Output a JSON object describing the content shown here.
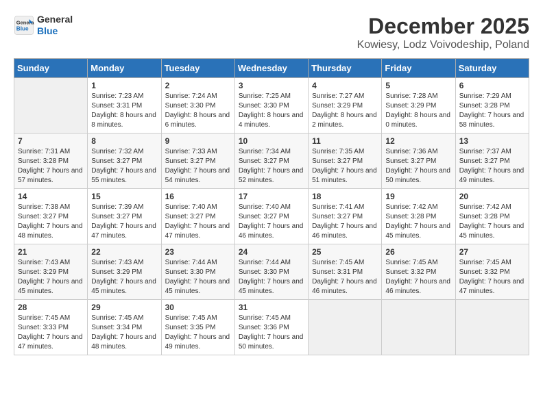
{
  "logo": {
    "line1": "General",
    "line2": "Blue"
  },
  "title": "December 2025",
  "subtitle": "Kowiesy, Lodz Voivodeship, Poland",
  "days_of_week": [
    "Sunday",
    "Monday",
    "Tuesday",
    "Wednesday",
    "Thursday",
    "Friday",
    "Saturday"
  ],
  "weeks": [
    [
      {
        "day": "",
        "sunrise": "",
        "sunset": "",
        "daylight": ""
      },
      {
        "day": "1",
        "sunrise": "Sunrise: 7:23 AM",
        "sunset": "Sunset: 3:31 PM",
        "daylight": "Daylight: 8 hours and 8 minutes."
      },
      {
        "day": "2",
        "sunrise": "Sunrise: 7:24 AM",
        "sunset": "Sunset: 3:30 PM",
        "daylight": "Daylight: 8 hours and 6 minutes."
      },
      {
        "day": "3",
        "sunrise": "Sunrise: 7:25 AM",
        "sunset": "Sunset: 3:30 PM",
        "daylight": "Daylight: 8 hours and 4 minutes."
      },
      {
        "day": "4",
        "sunrise": "Sunrise: 7:27 AM",
        "sunset": "Sunset: 3:29 PM",
        "daylight": "Daylight: 8 hours and 2 minutes."
      },
      {
        "day": "5",
        "sunrise": "Sunrise: 7:28 AM",
        "sunset": "Sunset: 3:29 PM",
        "daylight": "Daylight: 8 hours and 0 minutes."
      },
      {
        "day": "6",
        "sunrise": "Sunrise: 7:29 AM",
        "sunset": "Sunset: 3:28 PM",
        "daylight": "Daylight: 7 hours and 58 minutes."
      }
    ],
    [
      {
        "day": "7",
        "sunrise": "Sunrise: 7:31 AM",
        "sunset": "Sunset: 3:28 PM",
        "daylight": "Daylight: 7 hours and 57 minutes."
      },
      {
        "day": "8",
        "sunrise": "Sunrise: 7:32 AM",
        "sunset": "Sunset: 3:27 PM",
        "daylight": "Daylight: 7 hours and 55 minutes."
      },
      {
        "day": "9",
        "sunrise": "Sunrise: 7:33 AM",
        "sunset": "Sunset: 3:27 PM",
        "daylight": "Daylight: 7 hours and 54 minutes."
      },
      {
        "day": "10",
        "sunrise": "Sunrise: 7:34 AM",
        "sunset": "Sunset: 3:27 PM",
        "daylight": "Daylight: 7 hours and 52 minutes."
      },
      {
        "day": "11",
        "sunrise": "Sunrise: 7:35 AM",
        "sunset": "Sunset: 3:27 PM",
        "daylight": "Daylight: 7 hours and 51 minutes."
      },
      {
        "day": "12",
        "sunrise": "Sunrise: 7:36 AM",
        "sunset": "Sunset: 3:27 PM",
        "daylight": "Daylight: 7 hours and 50 minutes."
      },
      {
        "day": "13",
        "sunrise": "Sunrise: 7:37 AM",
        "sunset": "Sunset: 3:27 PM",
        "daylight": "Daylight: 7 hours and 49 minutes."
      }
    ],
    [
      {
        "day": "14",
        "sunrise": "Sunrise: 7:38 AM",
        "sunset": "Sunset: 3:27 PM",
        "daylight": "Daylight: 7 hours and 48 minutes."
      },
      {
        "day": "15",
        "sunrise": "Sunrise: 7:39 AM",
        "sunset": "Sunset: 3:27 PM",
        "daylight": "Daylight: 7 hours and 47 minutes."
      },
      {
        "day": "16",
        "sunrise": "Sunrise: 7:40 AM",
        "sunset": "Sunset: 3:27 PM",
        "daylight": "Daylight: 7 hours and 47 minutes."
      },
      {
        "day": "17",
        "sunrise": "Sunrise: 7:40 AM",
        "sunset": "Sunset: 3:27 PM",
        "daylight": "Daylight: 7 hours and 46 minutes."
      },
      {
        "day": "18",
        "sunrise": "Sunrise: 7:41 AM",
        "sunset": "Sunset: 3:27 PM",
        "daylight": "Daylight: 7 hours and 46 minutes."
      },
      {
        "day": "19",
        "sunrise": "Sunrise: 7:42 AM",
        "sunset": "Sunset: 3:28 PM",
        "daylight": "Daylight: 7 hours and 45 minutes."
      },
      {
        "day": "20",
        "sunrise": "Sunrise: 7:42 AM",
        "sunset": "Sunset: 3:28 PM",
        "daylight": "Daylight: 7 hours and 45 minutes."
      }
    ],
    [
      {
        "day": "21",
        "sunrise": "Sunrise: 7:43 AM",
        "sunset": "Sunset: 3:29 PM",
        "daylight": "Daylight: 7 hours and 45 minutes."
      },
      {
        "day": "22",
        "sunrise": "Sunrise: 7:43 AM",
        "sunset": "Sunset: 3:29 PM",
        "daylight": "Daylight: 7 hours and 45 minutes."
      },
      {
        "day": "23",
        "sunrise": "Sunrise: 7:44 AM",
        "sunset": "Sunset: 3:30 PM",
        "daylight": "Daylight: 7 hours and 45 minutes."
      },
      {
        "day": "24",
        "sunrise": "Sunrise: 7:44 AM",
        "sunset": "Sunset: 3:30 PM",
        "daylight": "Daylight: 7 hours and 45 minutes."
      },
      {
        "day": "25",
        "sunrise": "Sunrise: 7:45 AM",
        "sunset": "Sunset: 3:31 PM",
        "daylight": "Daylight: 7 hours and 46 minutes."
      },
      {
        "day": "26",
        "sunrise": "Sunrise: 7:45 AM",
        "sunset": "Sunset: 3:32 PM",
        "daylight": "Daylight: 7 hours and 46 minutes."
      },
      {
        "day": "27",
        "sunrise": "Sunrise: 7:45 AM",
        "sunset": "Sunset: 3:32 PM",
        "daylight": "Daylight: 7 hours and 47 minutes."
      }
    ],
    [
      {
        "day": "28",
        "sunrise": "Sunrise: 7:45 AM",
        "sunset": "Sunset: 3:33 PM",
        "daylight": "Daylight: 7 hours and 47 minutes."
      },
      {
        "day": "29",
        "sunrise": "Sunrise: 7:45 AM",
        "sunset": "Sunset: 3:34 PM",
        "daylight": "Daylight: 7 hours and 48 minutes."
      },
      {
        "day": "30",
        "sunrise": "Sunrise: 7:45 AM",
        "sunset": "Sunset: 3:35 PM",
        "daylight": "Daylight: 7 hours and 49 minutes."
      },
      {
        "day": "31",
        "sunrise": "Sunrise: 7:45 AM",
        "sunset": "Sunset: 3:36 PM",
        "daylight": "Daylight: 7 hours and 50 minutes."
      },
      {
        "day": "",
        "sunrise": "",
        "sunset": "",
        "daylight": ""
      },
      {
        "day": "",
        "sunrise": "",
        "sunset": "",
        "daylight": ""
      },
      {
        "day": "",
        "sunrise": "",
        "sunset": "",
        "daylight": ""
      }
    ]
  ]
}
